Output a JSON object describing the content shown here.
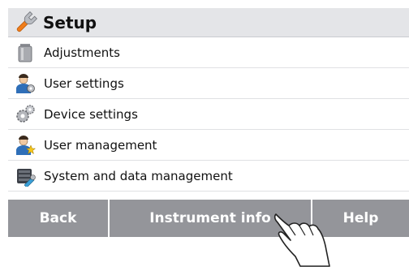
{
  "header": {
    "title": "Setup",
    "icon": "wrench-icon"
  },
  "menu": {
    "items": [
      {
        "label": "Adjustments",
        "icon": "weight-icon"
      },
      {
        "label": "User settings",
        "icon": "user-settings-icon"
      },
      {
        "label": "Device settings",
        "icon": "gears-icon"
      },
      {
        "label": "User management",
        "icon": "user-management-icon"
      },
      {
        "label": "System and data management",
        "icon": "system-data-icon"
      }
    ]
  },
  "footer": {
    "back_label": "Back",
    "info_label": "Instrument info",
    "help_label": "Help"
  },
  "colors": {
    "header_bg": "#e4e5e8",
    "footer_bg": "#94959a",
    "accent_orange": "#f07d1a"
  }
}
